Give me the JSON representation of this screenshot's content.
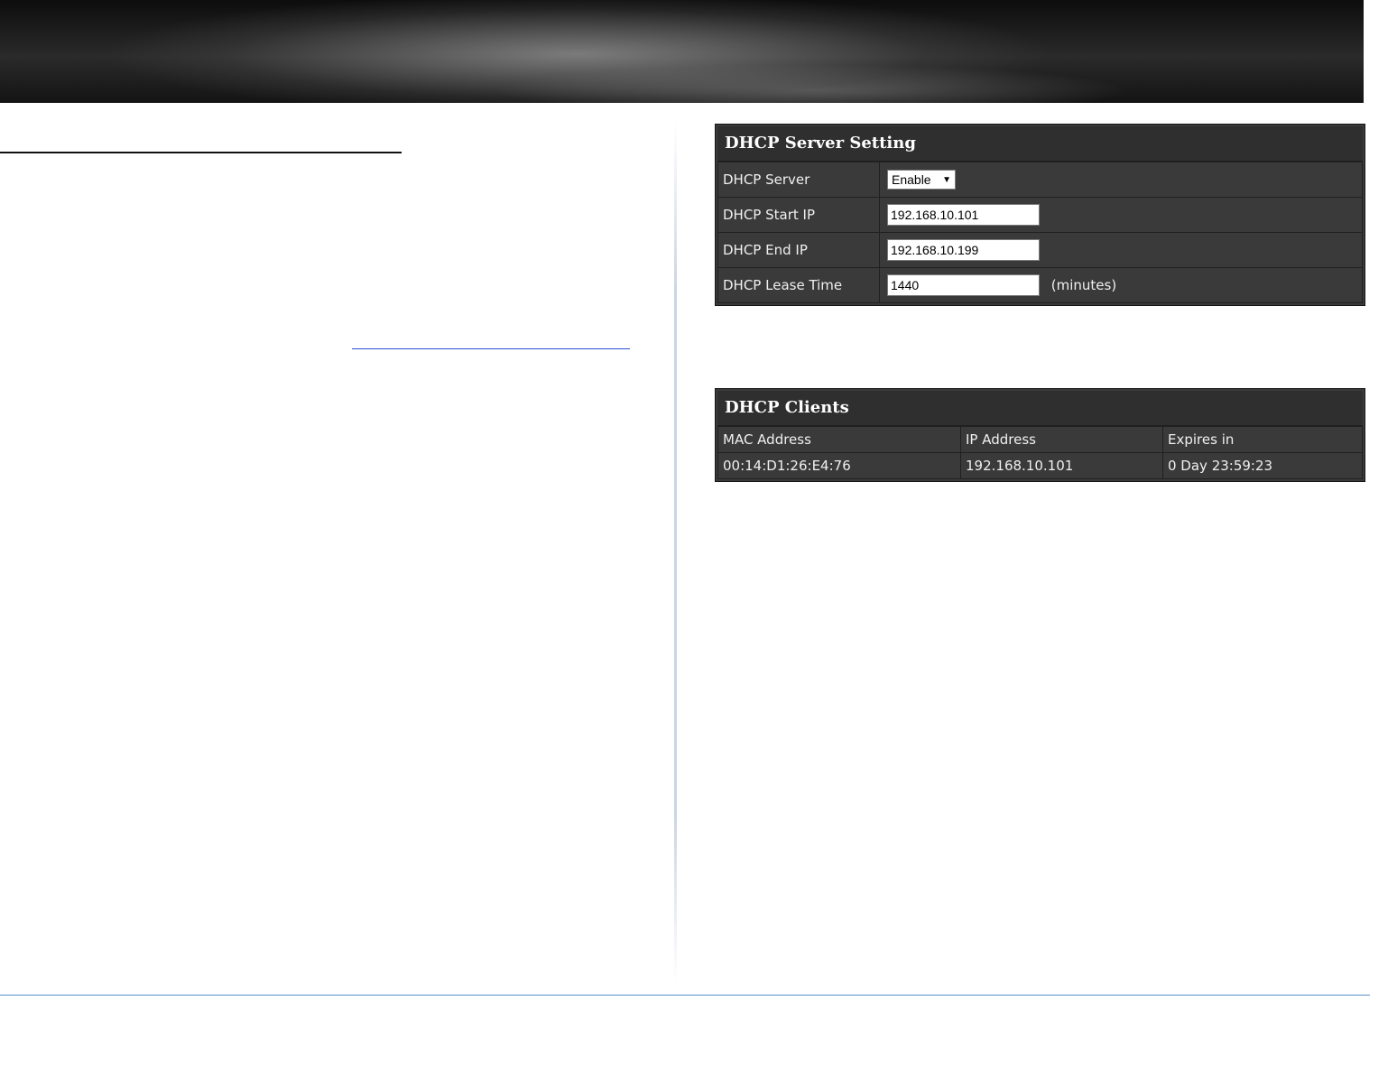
{
  "dhcp_server_setting": {
    "title": "DHCP Server Setting",
    "rows": [
      {
        "label": "DHCP Server",
        "value": "Enable"
      },
      {
        "label": "DHCP Start IP",
        "value": "192.168.10.101"
      },
      {
        "label": "DHCP End IP",
        "value": "192.168.10.199"
      },
      {
        "label": "DHCP Lease Time",
        "value": "1440",
        "unit": "(minutes)"
      }
    ]
  },
  "dhcp_clients": {
    "title": "DHCP Clients",
    "columns": [
      "MAC Address",
      "IP Address",
      "Expires in"
    ],
    "rows": [
      [
        "00:14:D1:26:E4:76",
        "192.168.10.101",
        "0 Day 23:59:23"
      ]
    ]
  }
}
